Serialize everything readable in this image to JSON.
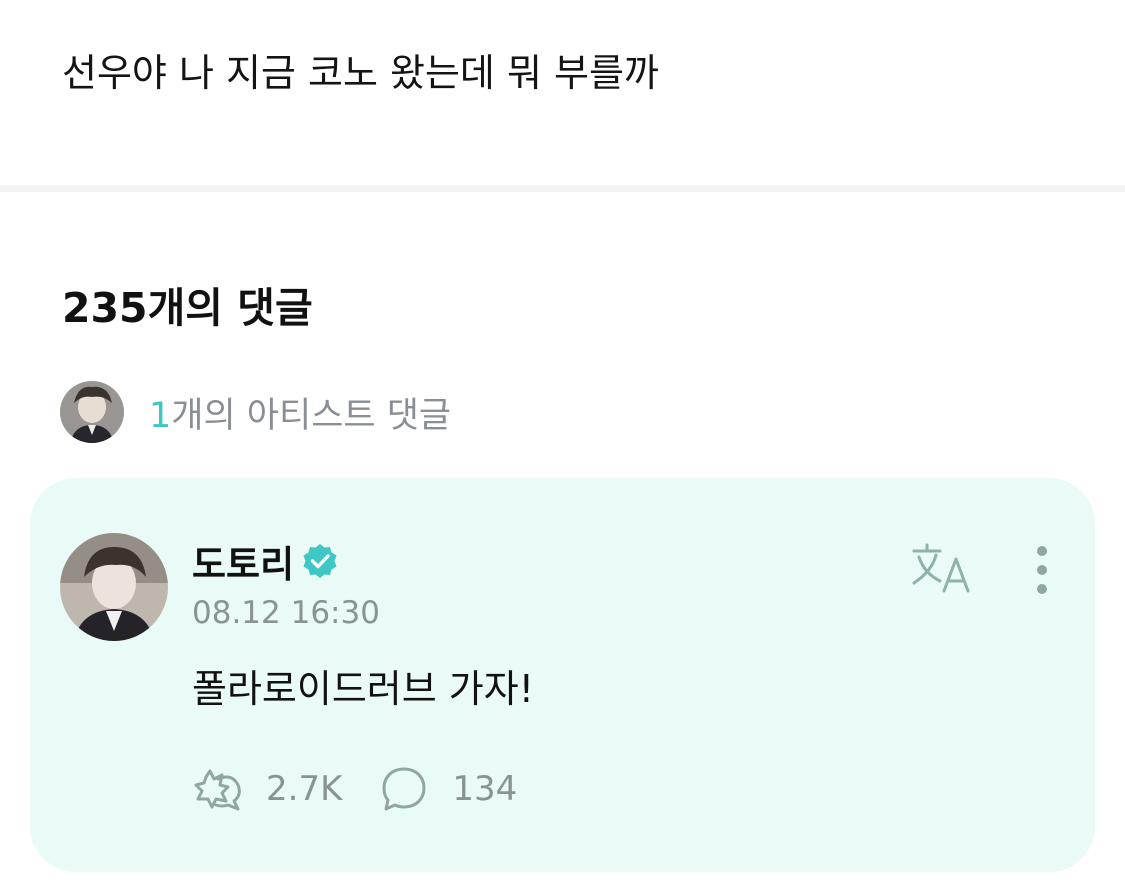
{
  "post": {
    "text": "선우야 나 지금 코노 왔는데 뭐 부를까"
  },
  "comments_section": {
    "title": "235개의 댓글",
    "artist_comments": {
      "count": "1",
      "label": "개의 아티스트 댓글"
    }
  },
  "comment": {
    "author": "도토리",
    "timestamp": "08.12 16:30",
    "text": "폴라로이드러브 가자!",
    "likes": "2.7K",
    "replies": "134"
  },
  "colors": {
    "accent": "#3ec7c4",
    "card_background": "#e9faf7",
    "muted_text": "#8a9393"
  },
  "icons": {
    "translate": "translate-icon",
    "more": "more-vertical-icon",
    "like": "like-icon",
    "reply": "comment-bubble-icon",
    "verified": "verified-badge-icon"
  }
}
